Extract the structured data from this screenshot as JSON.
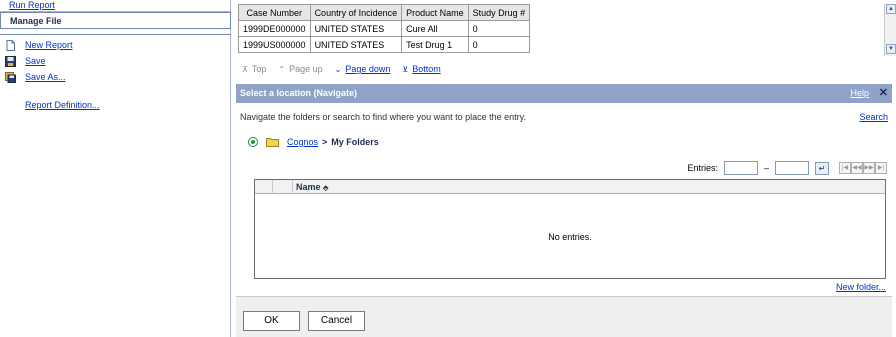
{
  "left_panel": {
    "run_report": "Run Report",
    "manage_file": "Manage File",
    "items": [
      {
        "label": "New Report",
        "icon": "new-document-icon"
      },
      {
        "label": "Save",
        "icon": "floppy-disk-icon"
      },
      {
        "label": "Save As...",
        "icon": "save-as-icon"
      },
      {
        "label": "Report Definition...",
        "icon": ""
      }
    ]
  },
  "results_table": {
    "columns": [
      "Case Number",
      "Country of Incidence",
      "Product Name",
      "Study Drug #"
    ],
    "rows": [
      [
        "1999DE000000",
        "UNITED STATES",
        "Cure All",
        "0"
      ],
      [
        "1999US000000",
        "UNITED STATES",
        "Test Drug 1",
        "0"
      ]
    ]
  },
  "pager": {
    "top": "Top",
    "page_up": "Page up",
    "page_down": "Page down",
    "bottom": "Bottom"
  },
  "dialog": {
    "title": "Select a location (Navigate)",
    "help": "Help",
    "close": "✕",
    "instructions": "Navigate the folders or search to find where you want to place the entry.",
    "search": "Search",
    "breadcrumb": {
      "root": "Cognos",
      "separator": ">",
      "current": "My Folders"
    },
    "entries_label": "Entries:",
    "entries_dash": "–",
    "list_header": "Name",
    "empty_text": "No entries.",
    "new_folder": "New folder...",
    "ok": "OK",
    "cancel": "Cancel"
  },
  "colors": {
    "header_bar": "#8ea3c7",
    "link": "#0033cc",
    "footer": "#efefef"
  }
}
